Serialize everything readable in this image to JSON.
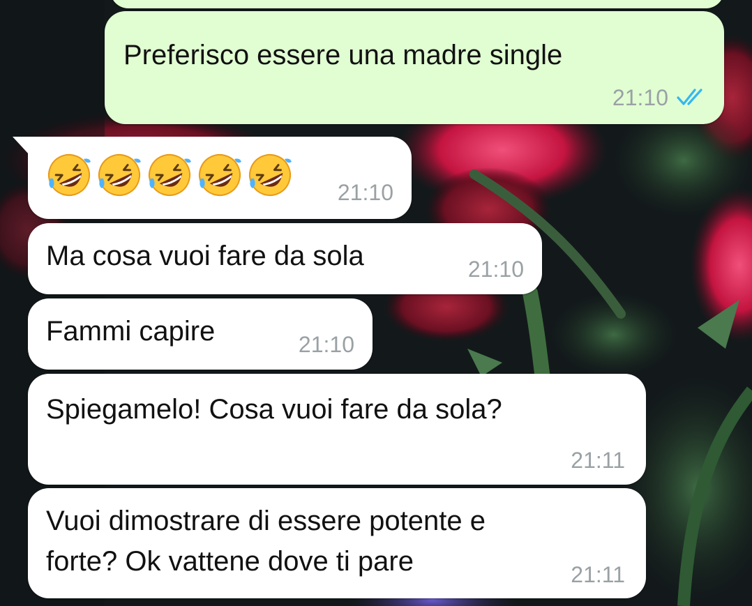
{
  "chat": {
    "messages": [
      {
        "direction": "outgoing",
        "text": "Preferisco essere una madre single",
        "time": "21:10",
        "status": "read"
      },
      {
        "direction": "incoming",
        "emoji_names": [
          "rolling-on-the-floor-laughing",
          "rolling-on-the-floor-laughing",
          "rolling-on-the-floor-laughing",
          "rolling-on-the-floor-laughing",
          "rolling-on-the-floor-laughing"
        ],
        "time": "21:10"
      },
      {
        "direction": "incoming",
        "text": "Ma cosa vuoi fare da sola",
        "time": "21:10"
      },
      {
        "direction": "incoming",
        "text": "Fammi capire",
        "time": "21:10"
      },
      {
        "direction": "incoming",
        "text": "Spiegamelo! Cosa vuoi fare da sola?",
        "time": "21:11"
      },
      {
        "direction": "incoming",
        "lines": [
          "Vuoi dimostrare di essere potente e",
          "forte? Ok vattene dove ti pare"
        ],
        "time": "21:11"
      }
    ]
  },
  "colors": {
    "incoming_bubble": "#ffffff",
    "outgoing_bubble": "#e1fed2",
    "timestamp": "#9aa1a4",
    "read_ticks": "#34b7f1",
    "wallpaper_base": "#13191b"
  },
  "icons": {
    "read_receipt": "double-check-icon",
    "emoji": "rolling-on-the-floor-laughing-emoji"
  }
}
